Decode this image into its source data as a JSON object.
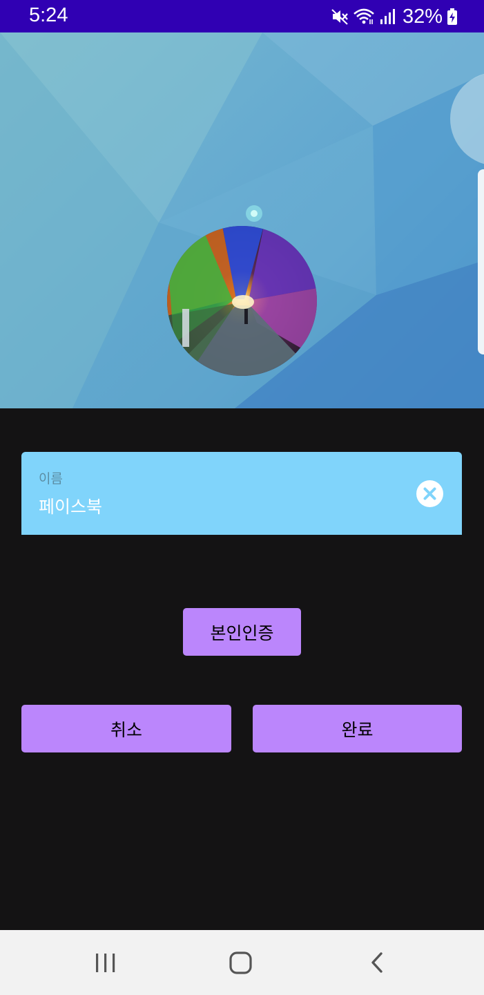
{
  "status_bar": {
    "time": "5:24",
    "battery_percent": "32%",
    "icons": [
      "mute-icon",
      "wifi-icon",
      "signal-icon",
      "battery-charging-icon"
    ]
  },
  "profile": {
    "cover_image": "abstract-blue-polygon-background",
    "avatar_image": "rainbow-light-tunnel-photo"
  },
  "name_field": {
    "label": "이름",
    "value": "페이스북",
    "clear_icon": "clear-icon"
  },
  "buttons": {
    "verify": "본인인증",
    "cancel": "취소",
    "done": "완료"
  },
  "nav_bar": {
    "icons": [
      "recents-icon",
      "home-icon",
      "back-icon"
    ]
  },
  "colors": {
    "status_bar": "#3000b3",
    "background": "#141314",
    "field_background": "#80d4fb",
    "button": "#bb86fc",
    "nav_bar": "#f2f2f2"
  }
}
